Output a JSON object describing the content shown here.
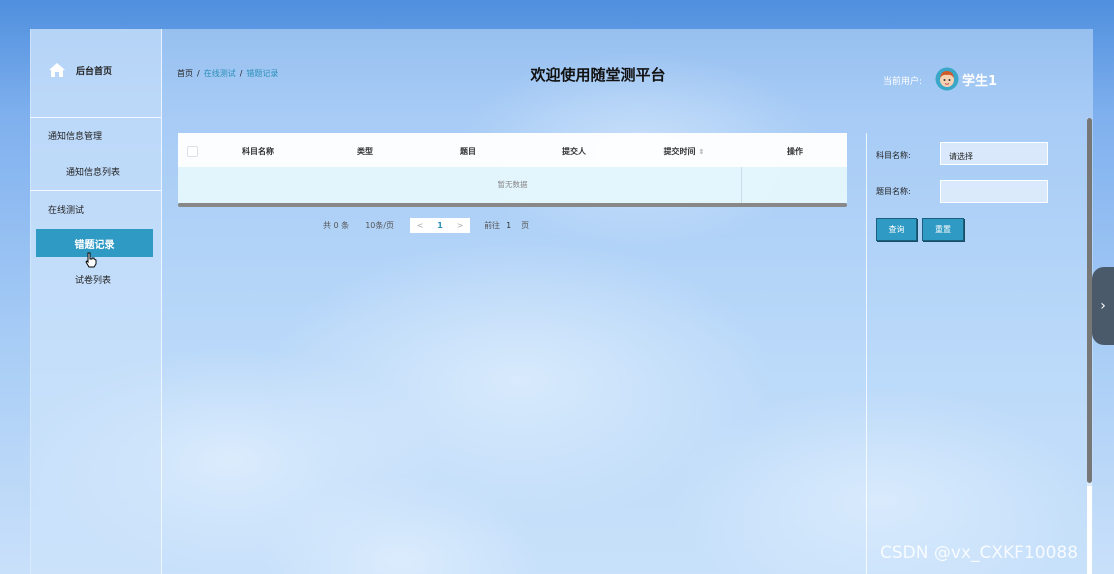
{
  "sidebar": {
    "home_label": "后台首页",
    "groups": [
      {
        "label": "通知信息管理",
        "items": [
          {
            "label": "通知信息列表"
          }
        ]
      },
      {
        "label": "在线测试",
        "items": [
          {
            "label": "错题记录",
            "active": true
          },
          {
            "label": "试卷列表"
          }
        ]
      }
    ]
  },
  "header": {
    "breadcrumb": [
      "首页",
      "在线测试",
      "错题记录"
    ],
    "breadcrumb_sep": "/",
    "title": "欢迎使用随堂测平台",
    "user_label": "当前用户:",
    "user_name": "学生1"
  },
  "table": {
    "columns": [
      "科目名称",
      "类型",
      "题目",
      "提交人",
      "提交时间",
      "操作"
    ],
    "empty_text": "暂无数据"
  },
  "pagination": {
    "total": "共 0 条",
    "page_size": "10条/页",
    "prev": "<",
    "current": "1",
    "next": ">",
    "goto_label": "前往",
    "goto_value": "1",
    "page_unit": "页"
  },
  "search": {
    "subject_label": "科目名称:",
    "subject_value": "请选择",
    "question_label": "题目名称:",
    "question_value": "",
    "query_button": "查询",
    "reset_button": "重置"
  },
  "watermark": "CSDN @vx_CXKF10088",
  "colors": {
    "accent": "#2f9ac3",
    "link": "#2a8fb8"
  }
}
